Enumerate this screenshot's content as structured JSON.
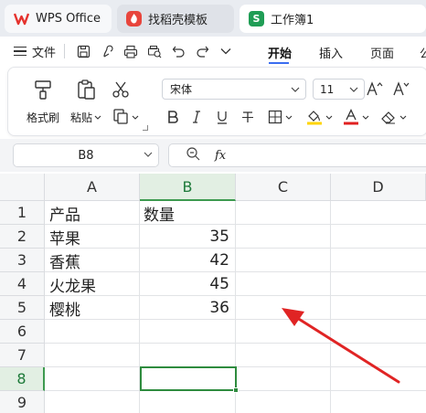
{
  "tabs": [
    {
      "label": "WPS Office",
      "icon": "wps-logo-icon"
    },
    {
      "label": "找稻壳模板",
      "icon": "docer-icon"
    },
    {
      "label": "工作簿1",
      "icon": "spreadsheet-icon",
      "icon_letter": "S"
    }
  ],
  "menu": {
    "file_label": "文件",
    "items": [
      "开始",
      "插入",
      "页面",
      "公"
    ],
    "active": "开始"
  },
  "ribbon": {
    "format_painter": "格式刷",
    "paste": "粘贴",
    "font_name": "宋体",
    "font_size": "11",
    "colors": {
      "highlight": "#ffd400",
      "font_color": "#e02020"
    }
  },
  "formula_bar": {
    "cell_ref": "B8",
    "fx_label": "fx",
    "formula": ""
  },
  "sheet": {
    "columns": [
      "A",
      "B",
      "C",
      "D"
    ],
    "selected_column": "B",
    "rows": [
      "1",
      "2",
      "3",
      "4",
      "5",
      "6",
      "7",
      "8",
      "9"
    ],
    "selected_row": "8",
    "header": {
      "product": "产品",
      "quantity": "数量"
    },
    "data": [
      {
        "product": "苹果",
        "quantity": "35"
      },
      {
        "product": "香蕉",
        "quantity": "42"
      },
      {
        "product": "火龙果",
        "quantity": "45"
      },
      {
        "product": "樱桃",
        "quantity": "36"
      }
    ],
    "active_cell": "B8"
  },
  "annotation": {
    "arrow_color": "#e02424"
  }
}
